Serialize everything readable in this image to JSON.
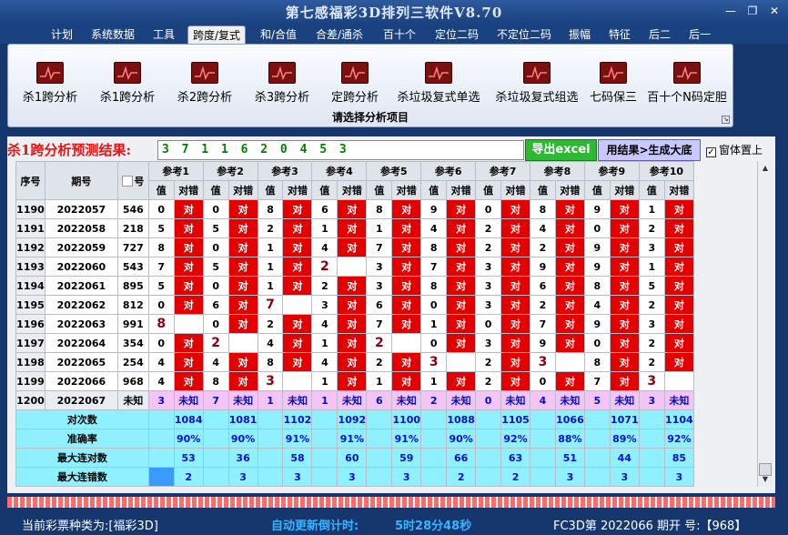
{
  "window": {
    "title": "第七感福彩3D排列三软件V8.70",
    "min": "—",
    "restore": "❐",
    "close": "✕"
  },
  "menu": [
    "计划",
    "系统数据",
    "工具",
    "跨度/复式",
    "和/合值",
    "合差/通杀",
    "百十个",
    "定位二码",
    "不定位二码",
    "振幅",
    "特征",
    "后二",
    "后一"
  ],
  "active_menu": "跨度/复式",
  "ribbon": {
    "items": [
      "杀1跨分析",
      "杀1跨分析",
      "杀2跨分析",
      "杀3跨分析",
      "定跨分析",
      "杀垃圾复式单选",
      "杀垃圾复式组选",
      "七码保三",
      "百十个N码定胆"
    ],
    "group_label": "请选择分析项目"
  },
  "prediction": {
    "label": "杀1跨分析预测结果:",
    "value": "3 7 1 1 6 2 0 4 5 3"
  },
  "buttons": {
    "excel": "导出excel",
    "generate": "用结果>生成大底",
    "topmost": "窗体置上"
  },
  "grid": {
    "headers": {
      "seq": "序号",
      "period": "期号",
      "num": "号",
      "value": "值",
      "match": "对错"
    },
    "groups": [
      "参考1",
      "参考2",
      "参考3",
      "参考4",
      "参考5",
      "参考6",
      "参考7",
      "参考8",
      "参考9",
      "参考10"
    ],
    "rows": [
      {
        "seq": "1190",
        "period": "2022057",
        "num": "546",
        "v": [
          "0",
          "0",
          "8",
          "6",
          "8",
          "9",
          "0",
          "8",
          "9",
          "1"
        ],
        "r": [
          1,
          1,
          1,
          1,
          1,
          1,
          1,
          1,
          1,
          1
        ],
        "b": [
          0,
          0,
          0,
          0,
          0,
          0,
          0,
          0,
          0,
          0
        ]
      },
      {
        "seq": "1191",
        "period": "2022058",
        "num": "218",
        "v": [
          "5",
          "5",
          "2",
          "1",
          "1",
          "4",
          "2",
          "4",
          "0",
          "2"
        ],
        "r": [
          1,
          1,
          1,
          1,
          1,
          1,
          1,
          1,
          1,
          1
        ],
        "b": [
          0,
          0,
          0,
          0,
          0,
          0,
          0,
          0,
          0,
          0
        ]
      },
      {
        "seq": "1192",
        "period": "2022059",
        "num": "727",
        "v": [
          "8",
          "0",
          "1",
          "4",
          "7",
          "8",
          "2",
          "2",
          "9",
          "3"
        ],
        "r": [
          1,
          1,
          1,
          1,
          1,
          1,
          1,
          1,
          1,
          1
        ],
        "b": [
          0,
          0,
          0,
          0,
          0,
          0,
          0,
          0,
          0,
          0
        ]
      },
      {
        "seq": "1193",
        "period": "2022060",
        "num": "543",
        "v": [
          "7",
          "5",
          "1",
          "2",
          "3",
          "7",
          "3",
          "9",
          "9",
          "1"
        ],
        "r": [
          1,
          1,
          1,
          0,
          1,
          1,
          1,
          1,
          1,
          1
        ],
        "b": [
          0,
          0,
          0,
          1,
          0,
          0,
          0,
          0,
          0,
          0
        ]
      },
      {
        "seq": "1194",
        "period": "2022061",
        "num": "895",
        "v": [
          "5",
          "0",
          "1",
          "2",
          "3",
          "8",
          "3",
          "6",
          "8",
          "5"
        ],
        "r": [
          1,
          1,
          1,
          1,
          1,
          1,
          1,
          1,
          1,
          1
        ],
        "b": [
          0,
          0,
          0,
          0,
          0,
          0,
          0,
          0,
          0,
          0
        ]
      },
      {
        "seq": "1195",
        "period": "2022062",
        "num": "812",
        "v": [
          "0",
          "6",
          "7",
          "3",
          "6",
          "0",
          "3",
          "2",
          "4",
          "2"
        ],
        "r": [
          1,
          1,
          0,
          1,
          1,
          1,
          1,
          1,
          1,
          1
        ],
        "b": [
          0,
          0,
          1,
          0,
          0,
          0,
          0,
          0,
          0,
          0
        ]
      },
      {
        "seq": "1196",
        "period": "2022063",
        "num": "991",
        "v": [
          "8",
          "0",
          "2",
          "4",
          "7",
          "1",
          "0",
          "7",
          "9",
          "3"
        ],
        "r": [
          0,
          1,
          1,
          1,
          1,
          1,
          1,
          1,
          1,
          1
        ],
        "b": [
          1,
          0,
          0,
          0,
          0,
          0,
          0,
          0,
          0,
          0
        ]
      },
      {
        "seq": "1197",
        "period": "2022064",
        "num": "354",
        "v": [
          "0",
          "2",
          "4",
          "1",
          "2",
          "0",
          "3",
          "9",
          "0",
          "2"
        ],
        "r": [
          1,
          0,
          1,
          1,
          0,
          1,
          1,
          1,
          1,
          1
        ],
        "b": [
          0,
          1,
          0,
          0,
          1,
          0,
          0,
          0,
          0,
          0
        ]
      },
      {
        "seq": "1198",
        "period": "2022065",
        "num": "254",
        "v": [
          "4",
          "4",
          "8",
          "4",
          "2",
          "3",
          "2",
          "3",
          "8",
          "2"
        ],
        "r": [
          1,
          1,
          1,
          1,
          1,
          0,
          1,
          0,
          1,
          1
        ],
        "b": [
          0,
          0,
          0,
          0,
          0,
          1,
          0,
          1,
          0,
          0
        ]
      },
      {
        "seq": "1199",
        "period": "2022066",
        "num": "968",
        "v": [
          "4",
          "8",
          "3",
          "1",
          "1",
          "1",
          "2",
          "0",
          "7",
          "3"
        ],
        "r": [
          1,
          1,
          0,
          1,
          1,
          1,
          1,
          1,
          1,
          0
        ],
        "b": [
          0,
          0,
          1,
          0,
          0,
          0,
          0,
          0,
          0,
          1
        ]
      }
    ],
    "unknown_row": {
      "seq": "1200",
      "period": "2022067",
      "num": "未知",
      "v": [
        "3",
        "7",
        "1",
        "1",
        "6",
        "2",
        "0",
        "4",
        "5",
        "3"
      ],
      "mark": "未知"
    },
    "stats": [
      {
        "label": "对次数",
        "vals": [
          "1084",
          "1081",
          "1102",
          "1092",
          "1100",
          "1088",
          "1105",
          "1066",
          "1071",
          "1104"
        ]
      },
      {
        "label": "准确率",
        "vals": [
          "90%",
          "90%",
          "91%",
          "91%",
          "91%",
          "90%",
          "92%",
          "88%",
          "89%",
          "92%"
        ]
      },
      {
        "label": "最大连对数",
        "vals": [
          "53",
          "36",
          "58",
          "60",
          "59",
          "66",
          "63",
          "51",
          "44",
          "85"
        ]
      },
      {
        "label": "最大连错数",
        "vals": [
          "2",
          "3",
          "3",
          "3",
          "3",
          "2",
          "2",
          "3",
          "3",
          "3"
        ]
      }
    ]
  },
  "status": {
    "left": "当前彩票种类为:[福彩3D]",
    "mid_label": "自动更新倒计时:",
    "mid_value": "5时28分48秒",
    "right": "FC3D第 2022066 期开  号:【968】"
  },
  "colors": {
    "red": "#e40000",
    "accent": "#16366e",
    "cyan": "#8ff0ff",
    "pink": "#f4c4f6"
  }
}
